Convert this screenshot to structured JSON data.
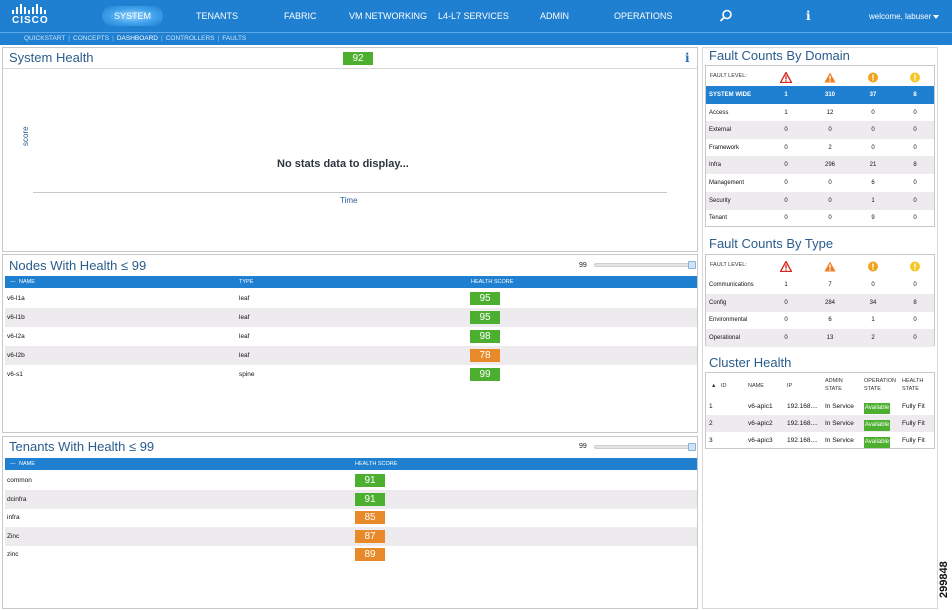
{
  "topnav": {
    "logo_text": "CISCO",
    "items": [
      "SYSTEM",
      "TENANTS",
      "FABRIC",
      "VM NETWORKING",
      "L4-L7 SERVICES",
      "ADMIN",
      "OPERATIONS"
    ],
    "active": "SYSTEM",
    "welcome": "welcome, labuser"
  },
  "subnav": {
    "items": [
      "QUICKSTART",
      "CONCEPTS",
      "DASHBOARD",
      "CONTROLLERS",
      "FAULTS"
    ],
    "active": "DASHBOARD"
  },
  "system_health": {
    "title": "System Health",
    "score": "92",
    "y_label": "score",
    "x_label": "Time",
    "empty_message": "No stats data to display..."
  },
  "nodes_health": {
    "title": "Nodes With Health ≤ 99",
    "slider_value": "99",
    "columns": [
      "NAME",
      "TYPE",
      "HEALTH SCORE"
    ],
    "rows": [
      {
        "name": "v6-l1a",
        "type": "leaf",
        "score": "95",
        "level": "green"
      },
      {
        "name": "v6-l1b",
        "type": "leaf",
        "score": "95",
        "level": "green"
      },
      {
        "name": "v6-l2a",
        "type": "leaf",
        "score": "98",
        "level": "green"
      },
      {
        "name": "v6-l2b",
        "type": "leaf",
        "score": "78",
        "level": "orange"
      },
      {
        "name": "v6-s1",
        "type": "spine",
        "score": "99",
        "level": "green"
      }
    ]
  },
  "tenants_health": {
    "title": "Tenants With Health ≤ 99",
    "slider_value": "99",
    "columns": [
      "NAME",
      "HEALTH SCORE"
    ],
    "rows": [
      {
        "name": "common",
        "score": "91",
        "level": "green"
      },
      {
        "name": "dcinfra",
        "score": "91",
        "level": "green"
      },
      {
        "name": "infra",
        "score": "85",
        "level": "orange"
      },
      {
        "name": "Zinc",
        "score": "87",
        "level": "orange"
      },
      {
        "name": "zinc",
        "score": "89",
        "level": "orange"
      }
    ]
  },
  "fault_domain": {
    "title": "Fault Counts By Domain",
    "level_label": "FAULT LEVEL:",
    "icons": [
      "critical-icon",
      "major-icon",
      "minor-icon",
      "warning-icon"
    ],
    "rows": [
      {
        "name": "SYSTEM WIDE",
        "values": [
          "1",
          "310",
          "37",
          "8"
        ]
      },
      {
        "name": "Access",
        "values": [
          "1",
          "12",
          "0",
          "0"
        ]
      },
      {
        "name": "External",
        "values": [
          "0",
          "0",
          "0",
          "0"
        ]
      },
      {
        "name": "Framework",
        "values": [
          "0",
          "2",
          "0",
          "0"
        ]
      },
      {
        "name": "Infra",
        "values": [
          "0",
          "296",
          "21",
          "8"
        ]
      },
      {
        "name": "Management",
        "values": [
          "0",
          "0",
          "6",
          "0"
        ]
      },
      {
        "name": "Security",
        "values": [
          "0",
          "0",
          "1",
          "0"
        ]
      },
      {
        "name": "Tenant",
        "values": [
          "0",
          "0",
          "9",
          "0"
        ]
      }
    ]
  },
  "fault_type": {
    "title": "Fault Counts By Type",
    "level_label": "FAULT LEVEL:",
    "rows": [
      {
        "name": "Communications",
        "values": [
          "1",
          "7",
          "0",
          "0"
        ]
      },
      {
        "name": "Config",
        "values": [
          "0",
          "284",
          "34",
          "8"
        ]
      },
      {
        "name": "Environmental",
        "values": [
          "0",
          "6",
          "1",
          "0"
        ]
      },
      {
        "name": "Operational",
        "values": [
          "0",
          "13",
          "2",
          "0"
        ]
      }
    ]
  },
  "cluster_health": {
    "title": "Cluster Health",
    "columns": [
      "ID",
      "NAME",
      "IP",
      "ADMIN STATE",
      "OPERATION STATE",
      "HEALTH STATE"
    ],
    "rows": [
      {
        "id": "1",
        "name": "v6-apic1",
        "ip": "192.168....",
        "admin": "In Service",
        "oper": "Available",
        "health": "Fully Fit"
      },
      {
        "id": "2",
        "name": "v6-apic2",
        "ip": "192.168....",
        "admin": "In Service",
        "oper": "Available",
        "health": "Fully Fit"
      },
      {
        "id": "3",
        "name": "v6-apic3",
        "ip": "192.168....",
        "admin": "In Service",
        "oper": "Available",
        "health": "Fully Fit"
      }
    ]
  },
  "side_code": "299848",
  "colors": {
    "nav_blue": "#1f7fd0",
    "health_green": "#4caf30",
    "health_orange": "#e88a2a",
    "title_blue": "#2a5c8c"
  }
}
